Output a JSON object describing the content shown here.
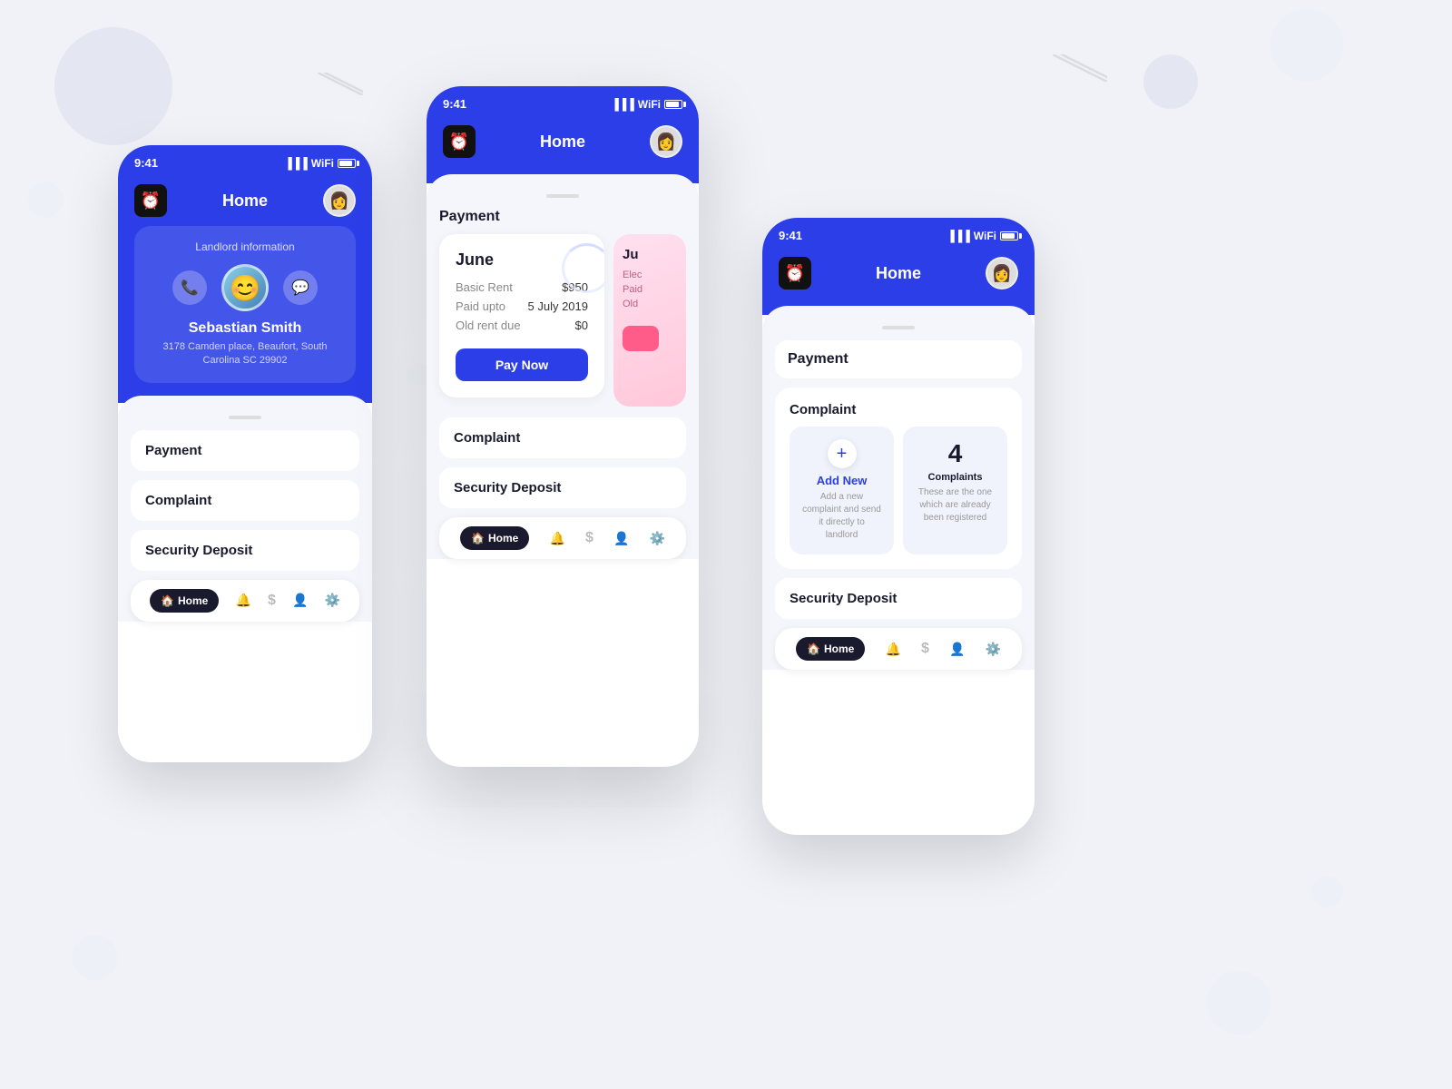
{
  "app": {
    "logo": "⏰",
    "title": "Home"
  },
  "phones": [
    {
      "id": "left",
      "time": "9:41",
      "landlord": {
        "label": "Landlord information",
        "name": "Sebastian Smith",
        "address": "3178 Camden place, Beaufort, South Carolina SC 29902"
      },
      "sections": [
        "Payment",
        "Complaint",
        "Security Deposit"
      ],
      "nav": [
        {
          "label": "Home",
          "icon": "🏠",
          "active": true
        },
        {
          "label": "",
          "icon": "🔔",
          "active": false
        },
        {
          "label": "",
          "icon": "$",
          "active": false
        },
        {
          "label": "",
          "icon": "👤",
          "active": false
        },
        {
          "label": "",
          "icon": "⚙️",
          "active": false
        }
      ]
    },
    {
      "id": "center",
      "time": "9:41",
      "payment": {
        "title": "Payment",
        "month": "June",
        "basicRentLabel": "Basic Rent",
        "basicRentValue": "$950",
        "paidUptoLabel": "Paid upto",
        "paidUptoValue": "5 July 2019",
        "oldRentLabel": "Old rent due",
        "oldRentValue": "$0",
        "payButtonLabel": "Pay Now"
      },
      "complaint": {
        "title": "Complaint"
      },
      "securityDeposit": {
        "title": "Security Deposit"
      },
      "nav": [
        {
          "label": "Home",
          "icon": "🏠",
          "active": true
        },
        {
          "label": "",
          "icon": "🔔",
          "active": false
        },
        {
          "label": "",
          "icon": "$",
          "active": false
        },
        {
          "label": "",
          "icon": "👤",
          "active": false
        },
        {
          "label": "",
          "icon": "⚙️",
          "active": false
        }
      ]
    },
    {
      "id": "right",
      "time": "9:41",
      "payment": {
        "title": "Payment"
      },
      "complaint": {
        "title": "Complaint",
        "addNew": {
          "icon": "+",
          "label": "Add New",
          "desc": "Add a new complaint and send it directly to landlord"
        },
        "count": {
          "number": "4",
          "label": "Complaints",
          "desc": "These are the one which are already been registered"
        }
      },
      "securityDeposit": {
        "title": "Security Deposit"
      },
      "nav": [
        {
          "label": "Home",
          "icon": "🏠",
          "active": true
        },
        {
          "label": "",
          "icon": "🔔",
          "active": false
        },
        {
          "label": "",
          "icon": "$",
          "active": false
        },
        {
          "label": "",
          "icon": "👤",
          "active": false
        },
        {
          "label": "",
          "icon": "⚙️",
          "active": false
        }
      ]
    }
  ],
  "colors": {
    "primary": "#2b3ee8",
    "background": "#f0f2f8",
    "white": "#ffffff",
    "lightBg": "#f5f6fb",
    "textDark": "#1a1a2e",
    "textGray": "#888"
  }
}
